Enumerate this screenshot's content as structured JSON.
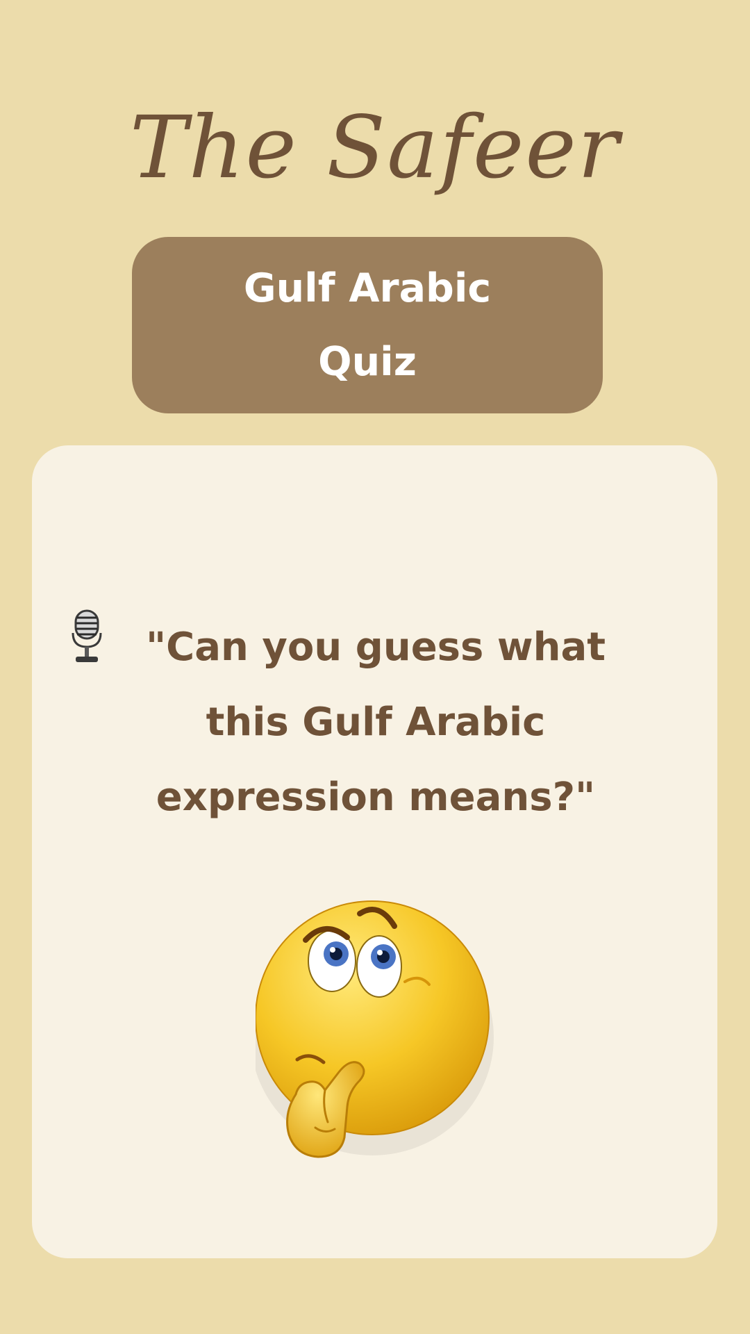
{
  "brand": {
    "title": "The Safeer"
  },
  "banner": {
    "label": "Gulf Arabic Quiz"
  },
  "card": {
    "question": "\"Can you guess what this Gulf Arabic expression means?\"",
    "leading_icon": "microphone-icon",
    "illustration": "thinking-face-emoji"
  },
  "colors": {
    "background": "#ecdcab",
    "banner": "#9c7f5c",
    "card": "#f8f2e4",
    "text_brown": "#6f5238",
    "banner_text": "#ffffff"
  }
}
